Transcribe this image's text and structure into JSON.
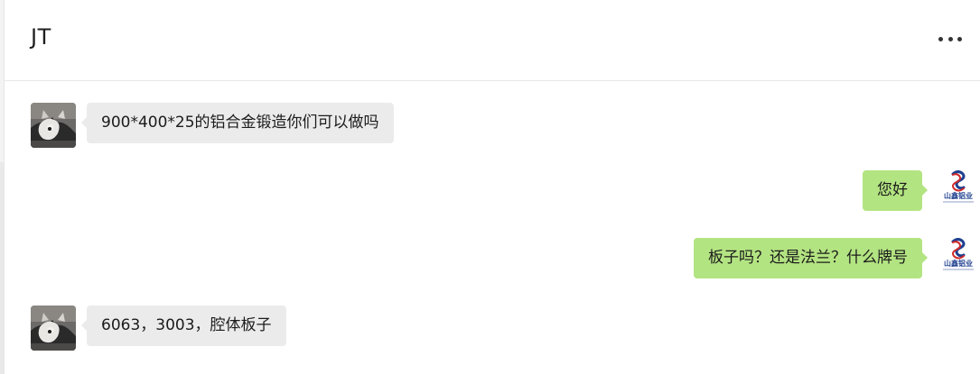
{
  "chat": {
    "title": "JT"
  },
  "header": {
    "more_icon": "more-horizontal-icon"
  },
  "messages": [
    {
      "side": "left",
      "sender_avatar": "husky-dog-avatar",
      "text": "900*400*25的铝合金锻造你们可以做吗"
    },
    {
      "side": "right",
      "sender_avatar": "company-logo-avatar",
      "text": "您好"
    },
    {
      "side": "right",
      "sender_avatar": "company-logo-avatar",
      "text": "板子吗？还是法兰？什么牌号"
    },
    {
      "side": "left",
      "sender_avatar": "husky-dog-avatar",
      "text": "6063，3003，腔体板子"
    }
  ],
  "company_logo": {
    "text": "山鑫铝业"
  },
  "colors": {
    "incoming_bubble": "#ebebeb",
    "outgoing_bubble": "#b3e482",
    "logo_blue": "#1f3f8f",
    "logo_red": "#d02a2a"
  }
}
